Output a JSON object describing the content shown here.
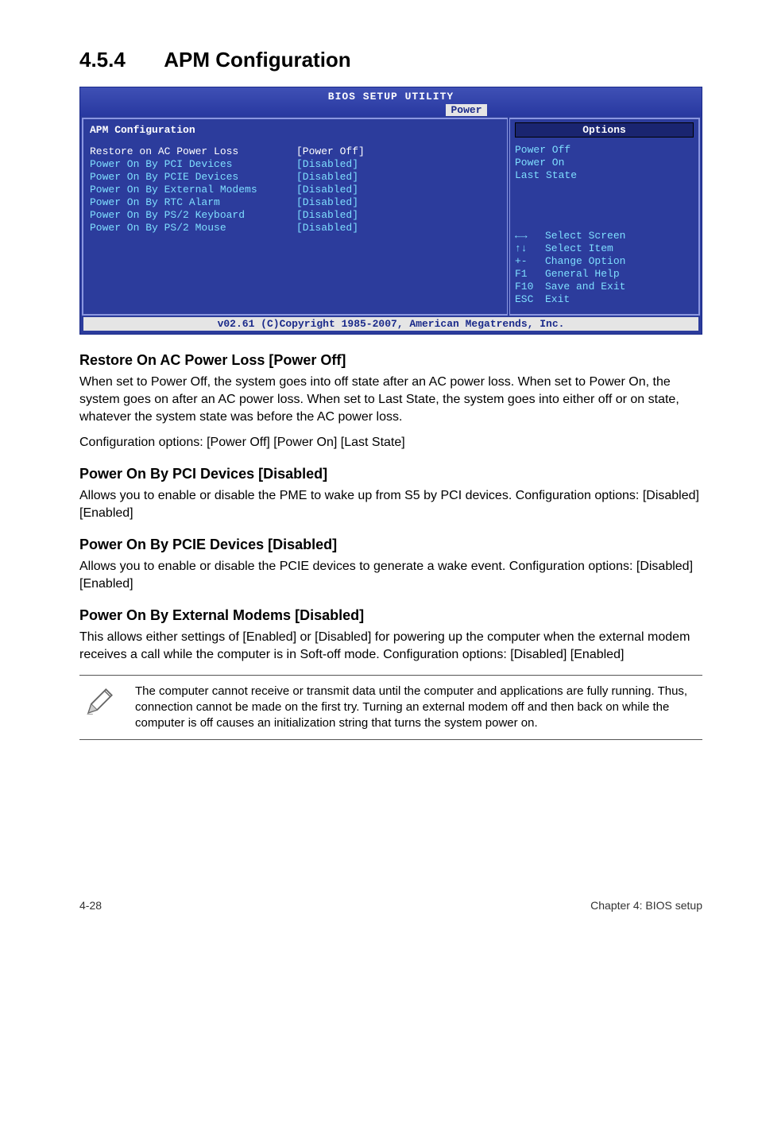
{
  "section": {
    "number": "4.5.4",
    "title": "APM Configuration"
  },
  "bios": {
    "top_title": "BIOS SETUP UTILITY",
    "tab": "Power",
    "left_title": "APM Configuration",
    "settings": [
      {
        "label": "Restore on AC Power Loss",
        "value": "[Power Off]",
        "selected": true
      },
      {
        "label": "Power On By PCI Devices",
        "value": "[Disabled]"
      },
      {
        "label": "Power On By PCIE Devices",
        "value": "[Disabled]"
      },
      {
        "label": "Power On By External Modems",
        "value": "[Disabled]"
      },
      {
        "label": "Power On By RTC Alarm",
        "value": "[Disabled]"
      },
      {
        "label": "Power On By PS/2 Keyboard",
        "value": "[Disabled]"
      },
      {
        "label": "Power On By PS/2 Mouse",
        "value": "[Disabled]"
      }
    ],
    "right": {
      "header": "Options",
      "options": [
        "Power Off",
        "Power On",
        "Last State"
      ],
      "nav": [
        {
          "key": "←→",
          "text": "Select Screen"
        },
        {
          "key": "↑↓",
          "text": "Select Item"
        },
        {
          "key": "+-",
          "text": "Change Option"
        },
        {
          "key": "F1",
          "text": "General Help"
        },
        {
          "key": "F10",
          "text": "Save and Exit"
        },
        {
          "key": "ESC",
          "text": "Exit"
        }
      ]
    },
    "footer": "v02.61 (C)Copyright 1985-2007, American Megatrends, Inc."
  },
  "sections": {
    "s1": {
      "heading": "Restore On AC Power Loss [Power Off]",
      "p1": "When set to Power Off, the system goes into off state after an AC power loss. When set to Power On, the system goes on after an AC power loss. When set to Last State, the system goes into either off or on state, whatever the system state was before the AC power loss.",
      "p2": "Configuration options: [Power Off] [Power On] [Last State]"
    },
    "s2": {
      "heading": "Power On By PCI Devices [Disabled]",
      "p1": "Allows you to enable or disable the PME to wake up from S5 by PCI devices. Configuration options: [Disabled] [Enabled]"
    },
    "s3": {
      "heading": "Power On By PCIE Devices [Disabled]",
      "p1": "Allows you to enable or disable the PCIE devices to generate a wake event. Configuration options: [Disabled] [Enabled]"
    },
    "s4": {
      "heading": "Power On By External Modems [Disabled]",
      "p1": "This allows either settings of [Enabled] or [Disabled] for powering up the computer when the external modem receives a call while the computer is in Soft-off mode. Configuration options: [Disabled] [Enabled]"
    }
  },
  "note": "The computer cannot receive or transmit data until the computer and applications are fully running. Thus, connection cannot be made on the first try. Turning an external modem off and then back on while the computer is off causes an initialization string that turns the system power on.",
  "footer": {
    "left": "4-28",
    "right": "Chapter 4: BIOS setup"
  }
}
